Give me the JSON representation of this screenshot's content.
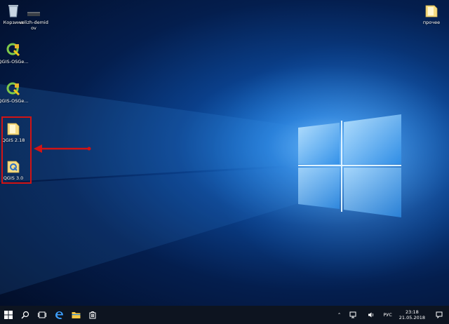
{
  "desktop": {
    "icons": [
      {
        "label": "Корзина",
        "icon": "recycle-bin-icon"
      },
      {
        "label": "velizh-demid",
        "label2": "ov",
        "icon": "user-folder-icon"
      },
      {
        "label": "QGIS-OSGe...",
        "icon": "qgis-icon"
      },
      {
        "label": "QGIS-OSGe...",
        "icon": "qgis-icon"
      },
      {
        "label": "QGIS 2.18",
        "icon": "folder-icon"
      },
      {
        "label": "QGIS 3.0",
        "icon": "qgis-folder-icon"
      },
      {
        "label": "прочее",
        "icon": "folder-icon"
      }
    ]
  },
  "annotation": {
    "color": "#d21414"
  },
  "taskbar": {
    "buttons": [
      "windows-start-icon",
      "search-icon",
      "task-view-icon",
      "edge-icon",
      "file-explorer-icon",
      "store-icon"
    ],
    "tray": {
      "language": "РУС",
      "time": "23:18",
      "date": "21.05.2018"
    }
  }
}
